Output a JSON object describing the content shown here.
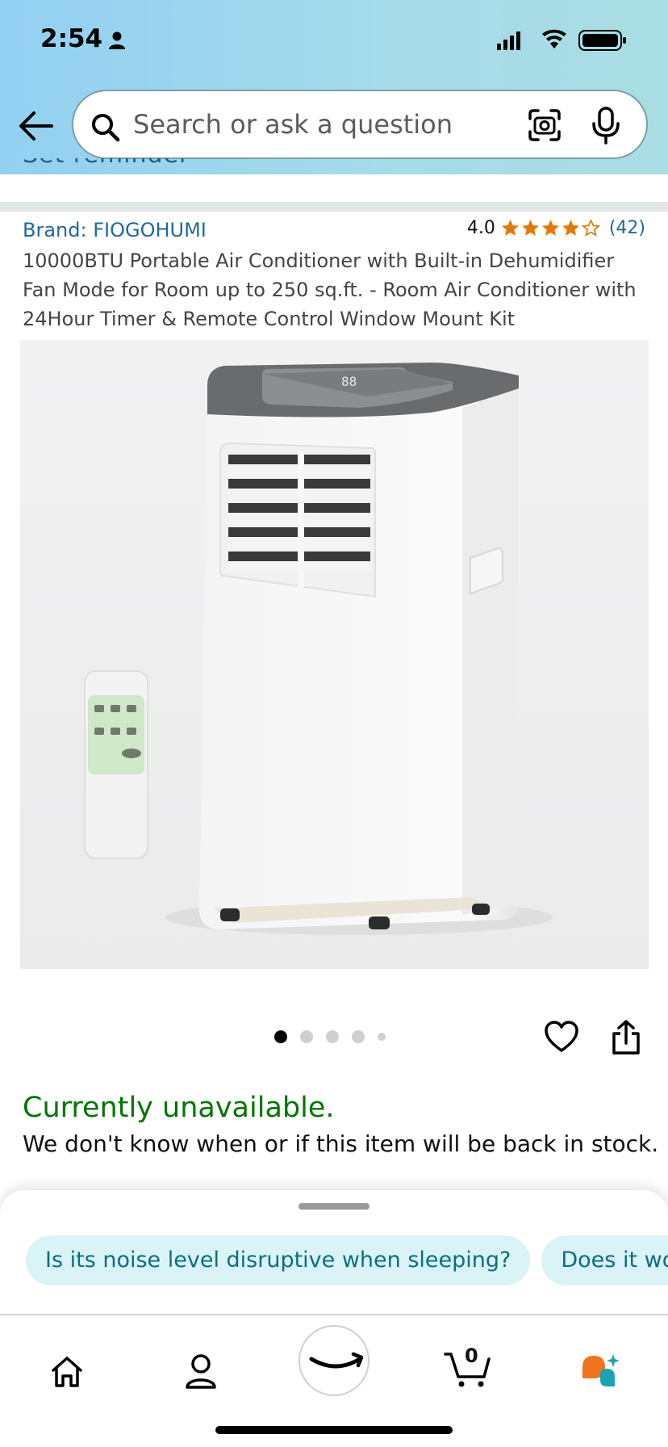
{
  "status_bar": {
    "time": "2:54"
  },
  "header": {
    "search": {
      "placeholder": "Search or ask a question"
    }
  },
  "scrolled_remnant": "Set reminder",
  "product": {
    "brand": "Brand: FIOGOHUMI",
    "rating_value": "4.0",
    "rating_fraction": 0.8,
    "rating_count": "(42)",
    "title": "10000BTU Portable Air Conditioner with Built-in Dehumidifier Fan Mode for Room up to 250 sq.ft. - Room Air Conditioner with 24Hour Timer & Remote Control Window Mount Kit",
    "image_count": 5,
    "active_image_index": 0,
    "remote_display": "88"
  },
  "availability": {
    "status": "Currently unavailable.",
    "note": "We don't know when or if this item will be back in stock."
  },
  "suggestions": [
    "Is its noise level disruptive when sleeping?",
    "Does it wo"
  ],
  "bottom_nav": {
    "cart_count": "0",
    "items": [
      "home-icon",
      "account-icon",
      "amazon-smile-icon",
      "cart-icon",
      "rufus-icon"
    ]
  },
  "colors": {
    "header_gradient_start": "#92d0f2",
    "header_gradient_end": "#a8dde3",
    "link": "#1e6b9a",
    "star": "#e77600",
    "unavailable": "#007600",
    "chip_bg": "#d9f3f7",
    "chip_text": "#0d6f7d",
    "rufus_orange": "#f0731e",
    "rufus_teal": "#1aa3b5"
  }
}
